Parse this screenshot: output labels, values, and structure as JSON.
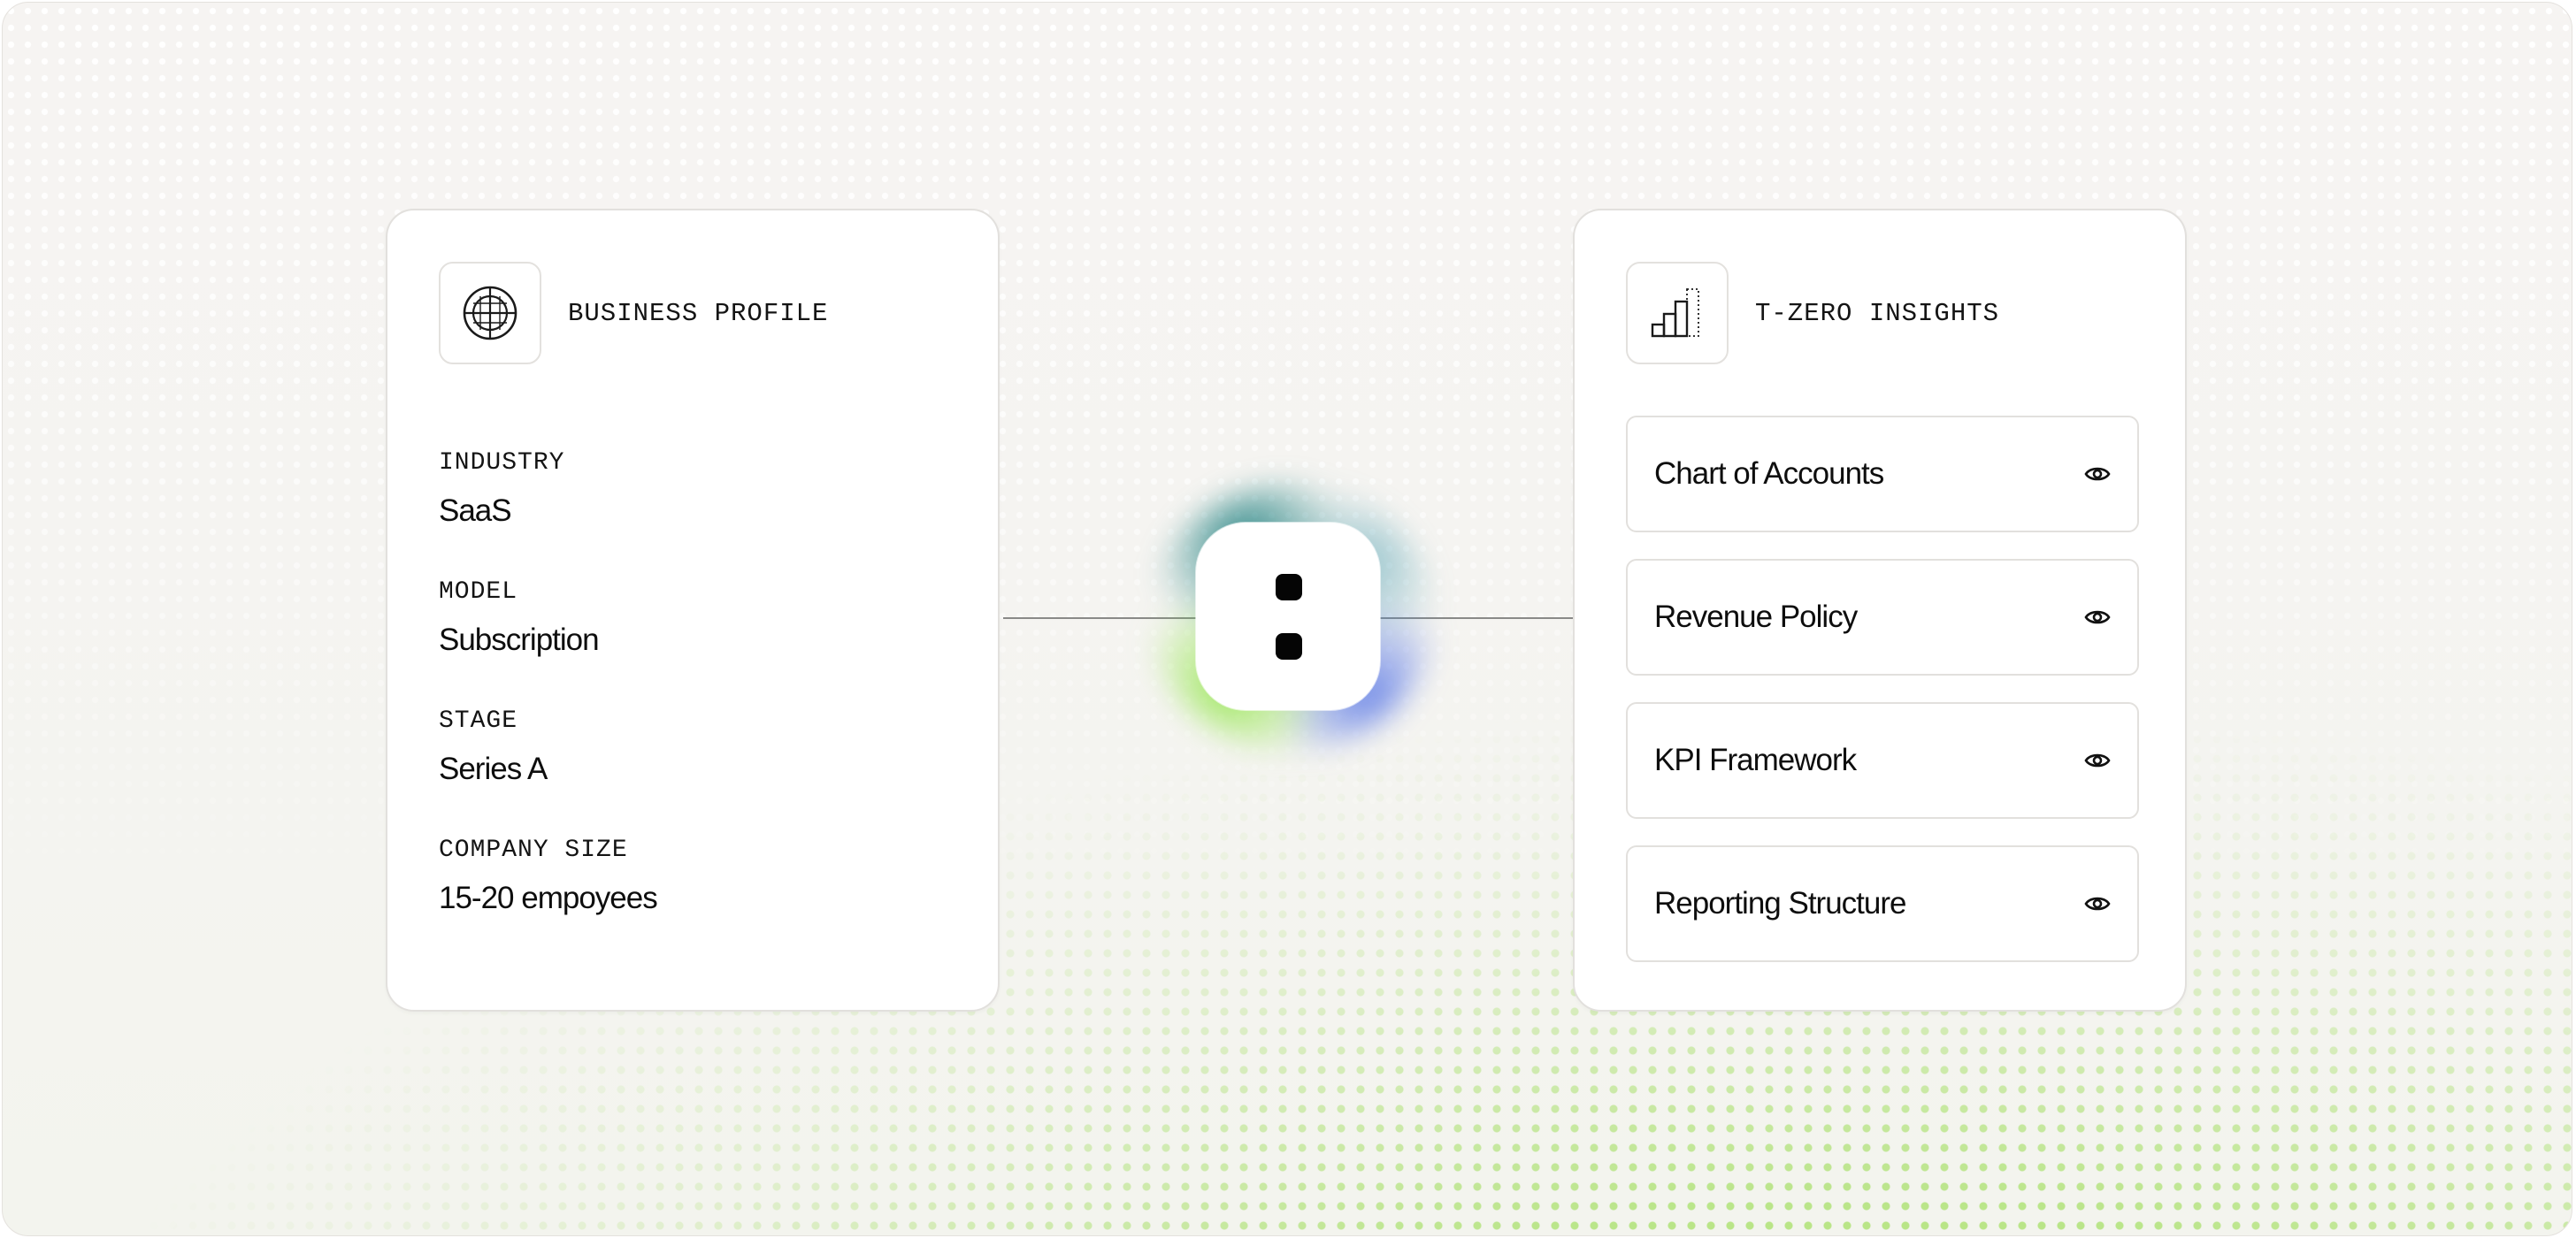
{
  "business_profile": {
    "title": "BUSINESS PROFILE",
    "icon": "target-icon",
    "fields": [
      {
        "label": "INDUSTRY",
        "value": "SaaS"
      },
      {
        "label": "MODEL",
        "value": "Subscription"
      },
      {
        "label": "STAGE",
        "value": "Series A"
      },
      {
        "label": "COMPANY SIZE",
        "value": "15-20 empoyees"
      }
    ]
  },
  "insights": {
    "title": "T-ZERO INSIGHTS",
    "icon": "bar-chart-icon",
    "items": [
      {
        "label": "Chart of Accounts",
        "icon": "eye-icon"
      },
      {
        "label": "Revenue Policy",
        "icon": "eye-icon"
      },
      {
        "label": "KPI Framework",
        "icon": "eye-icon"
      },
      {
        "label": "Reporting Structure",
        "icon": "eye-icon"
      }
    ]
  },
  "colors": {
    "background": "#f5f4f1",
    "dot_accent": "#a8e06a",
    "card_border": "#e2e0dd",
    "glow_teal": "#107878",
    "glow_green": "#96e650",
    "glow_blue": "#5a78e6",
    "text": "#0e0e0e"
  }
}
